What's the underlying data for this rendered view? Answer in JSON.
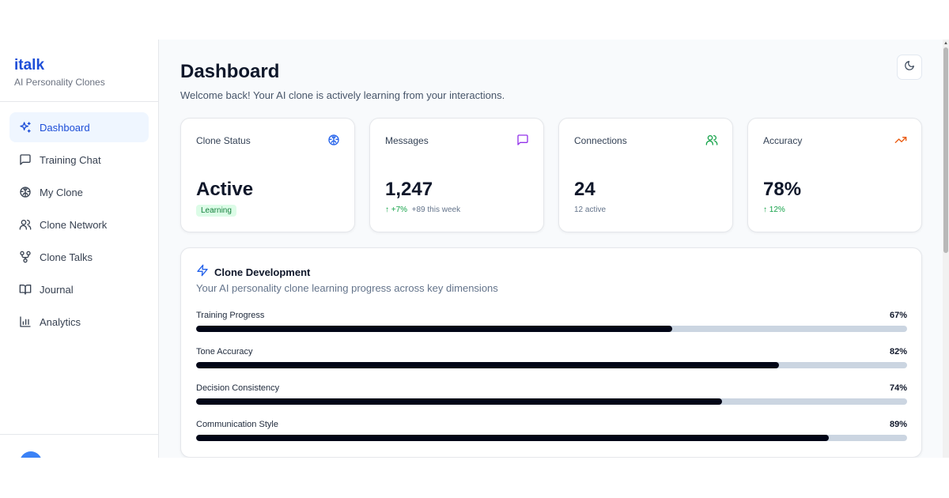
{
  "brand": {
    "name": "italk",
    "subtitle": "AI Personality Clones"
  },
  "nav": [
    {
      "label": "Dashboard",
      "icon": "sparkles-icon",
      "active": true
    },
    {
      "label": "Training Chat",
      "icon": "chat-bubble-icon",
      "active": false
    },
    {
      "label": "My Clone",
      "icon": "brain-icon",
      "active": false
    },
    {
      "label": "Clone Network",
      "icon": "users-icon",
      "active": false
    },
    {
      "label": "Clone Talks",
      "icon": "network-icon",
      "active": false
    },
    {
      "label": "Journal",
      "icon": "book-icon",
      "active": false
    },
    {
      "label": "Analytics",
      "icon": "bar-chart-icon",
      "active": false
    }
  ],
  "header": {
    "title": "Dashboard",
    "subtitle": "Welcome back! Your AI clone is actively learning from your interactions.",
    "theme_toggle_icon": "moon-icon"
  },
  "stats": [
    {
      "label": "Clone Status",
      "value": "Active",
      "badge": "Learning",
      "icon": "brain-icon",
      "icon_color": "#2563eb"
    },
    {
      "label": "Messages",
      "value": "1,247",
      "change": "↑ +7%",
      "note": "+89 this week",
      "icon": "chat-bubble-icon",
      "icon_color": "#9333ea"
    },
    {
      "label": "Connections",
      "value": "24",
      "note": "12 active",
      "icon": "users-icon",
      "icon_color": "#16a34a"
    },
    {
      "label": "Accuracy",
      "value": "78%",
      "change": "↑ 12%",
      "icon": "trending-up-icon",
      "icon_color": "#ea580c"
    }
  ],
  "development": {
    "title": "Clone Development",
    "subtitle": "Your AI personality clone learning progress across key dimensions",
    "icon": "lightning-icon",
    "metrics": [
      {
        "label": "Training Progress",
        "value": 67,
        "display": "67%"
      },
      {
        "label": "Tone Accuracy",
        "value": 82,
        "display": "82%"
      },
      {
        "label": "Decision Consistency",
        "value": 74,
        "display": "74%"
      },
      {
        "label": "Communication Style",
        "value": 89,
        "display": "89%"
      }
    ]
  },
  "colors": {
    "accent": "#1d4ed8",
    "active_bg": "#eff6ff",
    "progress_fill": "#020617",
    "progress_track": "#cbd5e1"
  }
}
